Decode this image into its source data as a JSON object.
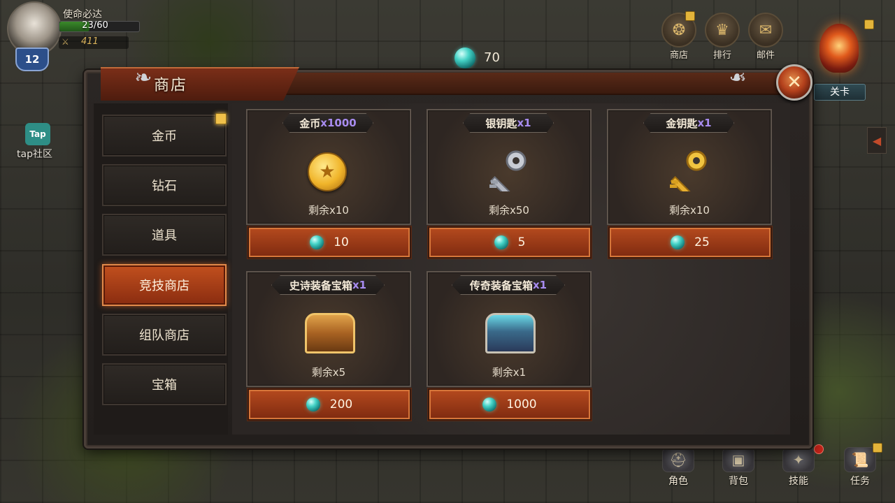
{
  "player": {
    "name": "使命必达",
    "hp_text": "23/60",
    "hp_fraction": 0.38,
    "power": "411",
    "level": "12"
  },
  "currency": {
    "gems": "70",
    "icon": "gem-icon"
  },
  "top_menu": [
    {
      "label": "商店",
      "icon": "shop-icon"
    },
    {
      "label": "排行",
      "icon": "ranking-icon"
    },
    {
      "label": "邮件",
      "icon": "mail-icon"
    }
  ],
  "stage": {
    "label": "关卡"
  },
  "tap": {
    "badge": "Tap",
    "label": "tap社区"
  },
  "bottom_nav": [
    {
      "label": "角色",
      "icon": "helmet-icon"
    },
    {
      "label": "背包",
      "icon": "backpack-icon"
    },
    {
      "label": "技能",
      "icon": "skill-book-icon"
    },
    {
      "label": "任务",
      "icon": "scroll-icon"
    }
  ],
  "shop": {
    "title": "商店",
    "close_icon": "close-icon",
    "tabs": [
      {
        "label": "金币",
        "active": false,
        "badge": true
      },
      {
        "label": "钻石",
        "active": false
      },
      {
        "label": "道具",
        "active": false
      },
      {
        "label": "竞技商店",
        "active": true
      },
      {
        "label": "组队商店",
        "active": false
      },
      {
        "label": "宝箱",
        "active": false
      }
    ],
    "items": [
      {
        "name": "金币",
        "qty": "x1000",
        "remain": "剩余x10",
        "price": "10",
        "icon": "gold-coin-icon"
      },
      {
        "name": "银钥匙",
        "qty": " x1",
        "remain": "剩余x50",
        "price": "5",
        "icon": "silver-key-icon"
      },
      {
        "name": "金钥匙",
        "qty": " x1",
        "remain": "剩余x10",
        "price": "25",
        "icon": "gold-key-icon"
      },
      {
        "name": "史诗装备宝箱",
        "qty": "x1",
        "remain": "剩余x5",
        "price": "200",
        "icon": "epic-chest-icon"
      },
      {
        "name": "传奇装备宝箱",
        "qty": "x1",
        "remain": "剩余x1",
        "price": "1000",
        "icon": "legendary-chest-icon"
      }
    ]
  },
  "colors": {
    "accent": "#b54a1e",
    "qty_purple": "#a88cf0",
    "gem": "#45d3c7",
    "panel": "#2b2624"
  }
}
